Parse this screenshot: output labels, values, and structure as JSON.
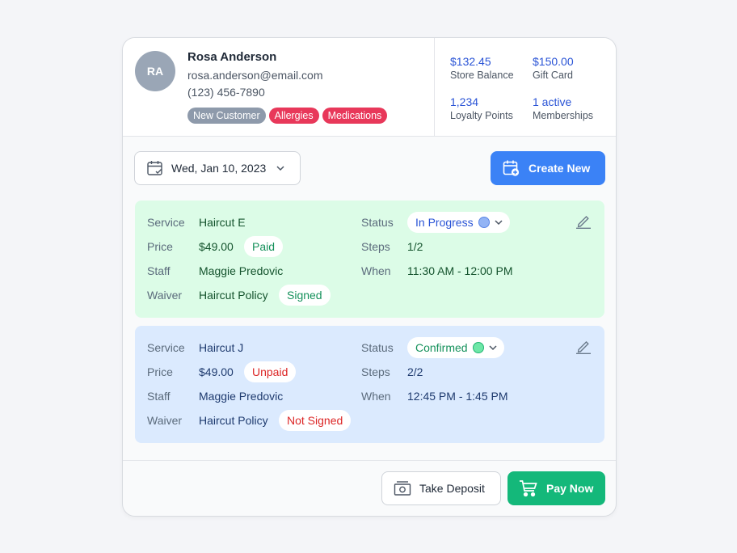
{
  "customer": {
    "initials": "RA",
    "name": "Rosa Anderson",
    "email": "rosa.anderson@email.com",
    "phone": "(123) 456-7890",
    "tags": [
      "New Customer",
      "Allergies",
      "Medications"
    ]
  },
  "stats": [
    {
      "value": "$132.45",
      "label": "Store Balance"
    },
    {
      "value": "$150.00",
      "label": "Gift Card"
    },
    {
      "value": "1,234",
      "label": "Loyalty Points"
    },
    {
      "value": "1 active",
      "label": "Memberships"
    }
  ],
  "toolbar": {
    "date": "Wed, Jan 10, 2023",
    "create_label": "Create New"
  },
  "labels": {
    "service": "Service",
    "price": "Price",
    "staff": "Staff",
    "waiver": "Waiver",
    "status": "Status",
    "steps": "Steps",
    "when": "When"
  },
  "appointments": [
    {
      "service": "Haircut E",
      "price": "$49.00",
      "payment": "Paid",
      "staff": "Maggie Predovic",
      "waiver": "Haircut Policy",
      "waiver_status": "Signed",
      "status": "In Progress",
      "steps": "1/2",
      "when": "11:30 AM - 12:00 PM"
    },
    {
      "service": "Haircut J",
      "price": "$49.00",
      "payment": "Unpaid",
      "staff": "Maggie Predovic",
      "waiver": "Haircut Policy",
      "waiver_status": "Not Signed",
      "status": "Confirmed",
      "steps": "2/2",
      "when": "12:45 PM - 1:45 PM"
    }
  ],
  "footer": {
    "deposit_label": "Take Deposit",
    "pay_label": "Pay Now"
  },
  "colors": {
    "primary_blue": "#3b82f6",
    "pay_green": "#14b87a",
    "tag_red": "#e8385a",
    "in_progress_dot": "#93b4f5",
    "confirmed_dot": "#6ee7a7"
  }
}
